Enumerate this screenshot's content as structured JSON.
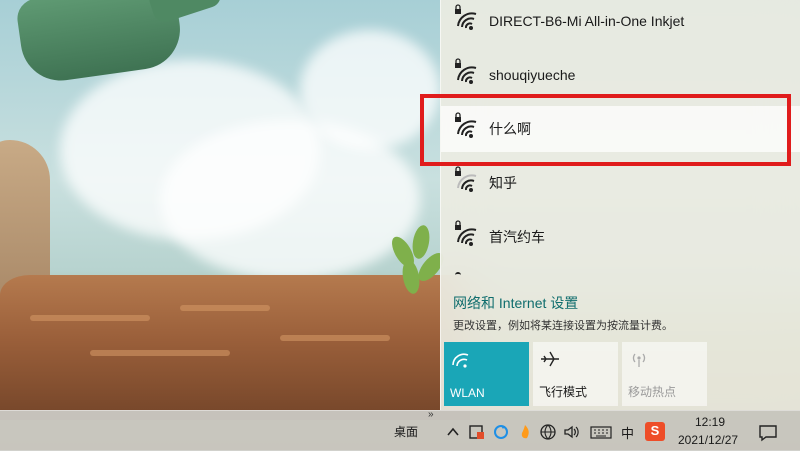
{
  "networks": [
    {
      "name": "DIRECT-B6-Mi All-in-One Inkjet",
      "secured": true
    },
    {
      "name": "shouqiyueche",
      "secured": true
    },
    {
      "name": "什么啊",
      "secured": true,
      "selected": true
    },
    {
      "name": "知乎",
      "secured": true
    },
    {
      "name": "首汽约车",
      "secured": true
    }
  ],
  "settings": {
    "link_text": "网络和 Internet 设置",
    "description": "更改设置，例如将某连接设置为按流量计费。"
  },
  "tiles": [
    {
      "label": "WLAN",
      "state": "active",
      "icon": "wifi-icon"
    },
    {
      "label": "飞行模式",
      "state": "normal",
      "icon": "airplane-icon"
    },
    {
      "label": "移动热点",
      "state": "disabled",
      "icon": "hotspot-icon"
    }
  ],
  "taskbar": {
    "desktop_label": "桌面",
    "ime_label": "中",
    "ime_s_label": "S",
    "time": "12:19",
    "date": "2021/12/27"
  },
  "colors": {
    "accent": "#1aa6b7",
    "highlight": "#e01c1c",
    "link": "#0f6d6d"
  }
}
